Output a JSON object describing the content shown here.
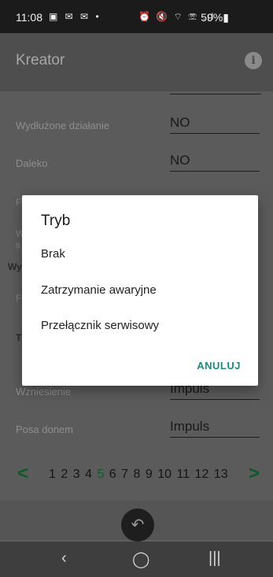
{
  "status_bar": {
    "time": "11:08",
    "notification_icons": "▣ ✉ ✉ •",
    "system_icons": "⏰ 🔇 ⌔ ☏ .ıl",
    "battery": "59%▮"
  },
  "app_bar": {
    "title": "Kreator",
    "info_glyph": "i"
  },
  "settings": {
    "rows": [
      {
        "label": "Wydłużone działanie",
        "value": "NO"
      },
      {
        "label": "Daleko",
        "value": "NO"
      },
      {
        "label": "Wzniesienie",
        "value": "Impuls"
      },
      {
        "label": "Posa donem",
        "value": "Impuls"
      }
    ],
    "peek_labels": [
      "F",
      "W",
      "s",
      "Wy",
      "F",
      "T"
    ]
  },
  "pager": {
    "prev_glyph": "<",
    "next_glyph": ">",
    "pages": [
      "1",
      "2",
      "3",
      "4",
      "5",
      "6",
      "7",
      "8",
      "9",
      "10",
      "11",
      "12",
      "13"
    ],
    "current_page": "5"
  },
  "bottom": {
    "back_fab_glyph": "↶"
  },
  "nav_bar": {
    "back_glyph": "‹",
    "home_glyph": "◯",
    "recents_glyph": "|||"
  },
  "dialog": {
    "title": "Tryb",
    "options": [
      "Brak",
      "Zatrzymanie awaryjne",
      "Przełącznik serwisowy"
    ],
    "cancel_label": "ANULUJ"
  },
  "colors": {
    "accent_green": "#0e5b29",
    "dialog_button": "#1a8c80"
  }
}
